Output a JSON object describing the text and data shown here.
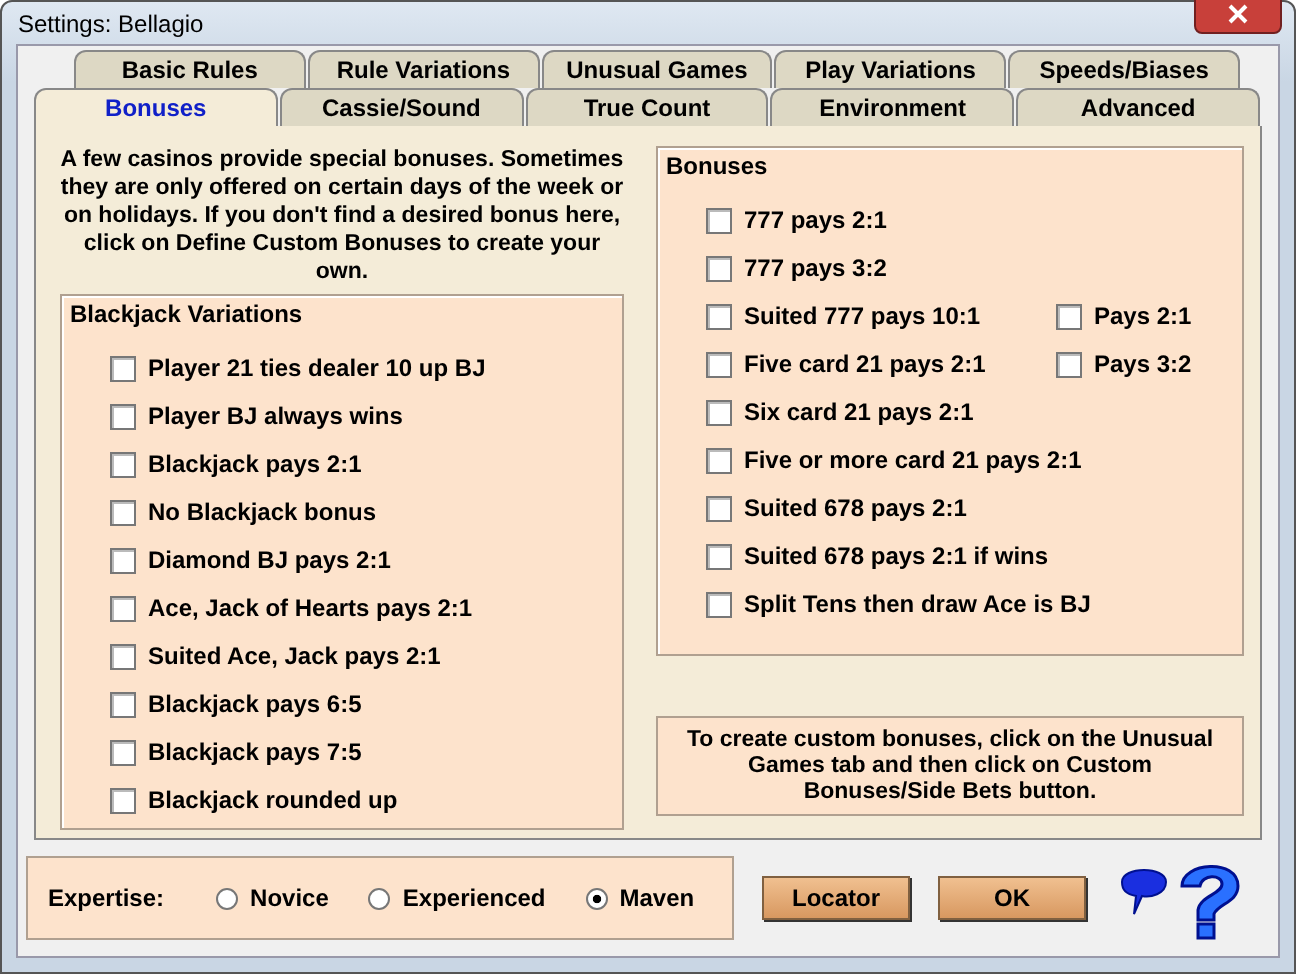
{
  "window": {
    "title": "Settings: Bellagio"
  },
  "tab_rows": [
    [
      {
        "label": "Basic Rules",
        "selected": false
      },
      {
        "label": "Rule Variations",
        "selected": false
      },
      {
        "label": "Unusual Games",
        "selected": false
      },
      {
        "label": "Play Variations",
        "selected": false
      },
      {
        "label": "Speeds/Biases",
        "selected": false
      }
    ],
    [
      {
        "label": "Bonuses",
        "selected": true
      },
      {
        "label": "Cassie/Sound",
        "selected": false
      },
      {
        "label": "True Count",
        "selected": false
      },
      {
        "label": "Environment",
        "selected": false
      },
      {
        "label": "Advanced",
        "selected": false
      }
    ]
  ],
  "intro": "A few casinos provide special bonuses. Sometimes they are only offered on certain days of the week or on holidays. If you don't find a desired bonus here, click on Define Custom Bonuses to create your own.",
  "blackjack_variations": {
    "title": "Blackjack Variations",
    "items": [
      {
        "label": "Player 21 ties dealer 10 up BJ",
        "checked": false
      },
      {
        "label": "Player BJ always wins",
        "checked": false
      },
      {
        "label": "Blackjack pays 2:1",
        "checked": false
      },
      {
        "label": "No Blackjack bonus",
        "checked": false
      },
      {
        "label": "Diamond BJ pays 2:1",
        "checked": false
      },
      {
        "label": "Ace, Jack of Hearts pays 2:1",
        "checked": false
      },
      {
        "label": "Suited Ace, Jack pays 2:1",
        "checked": false
      },
      {
        "label": "Blackjack pays 6:5",
        "checked": false
      },
      {
        "label": "Blackjack pays 7:5",
        "checked": false
      },
      {
        "label": "Blackjack rounded up",
        "checked": false
      }
    ]
  },
  "bonuses": {
    "title": "Bonuses",
    "items": [
      {
        "label": "777 pays 2:1",
        "checked": false
      },
      {
        "label": "777 pays 3:2",
        "checked": false
      },
      {
        "label": "Suited 777 pays 10:1",
        "checked": false,
        "side": {
          "label": "Pays 2:1",
          "checked": false
        }
      },
      {
        "label": "Five card 21 pays 2:1",
        "checked": false,
        "side": {
          "label": "Pays 3:2",
          "checked": false
        }
      },
      {
        "label": "Six card 21 pays 2:1",
        "checked": false
      },
      {
        "label": "Five or more card 21 pays 2:1",
        "checked": false
      },
      {
        "label": "Suited 678 pays 2:1",
        "checked": false
      },
      {
        "label": "Suited 678 pays 2:1 if wins",
        "checked": false
      },
      {
        "label": "Split Tens then draw Ace is BJ",
        "checked": false
      }
    ]
  },
  "note": "To create custom bonuses, click on the Unusual Games tab and then click on Custom Bonuses/Side Bets button.",
  "expertise": {
    "label": "Expertise:",
    "options": [
      {
        "label": "Novice",
        "selected": false
      },
      {
        "label": "Experienced",
        "selected": false
      },
      {
        "label": "Maven",
        "selected": true
      }
    ]
  },
  "buttons": [
    "Locator",
    "OK"
  ]
}
